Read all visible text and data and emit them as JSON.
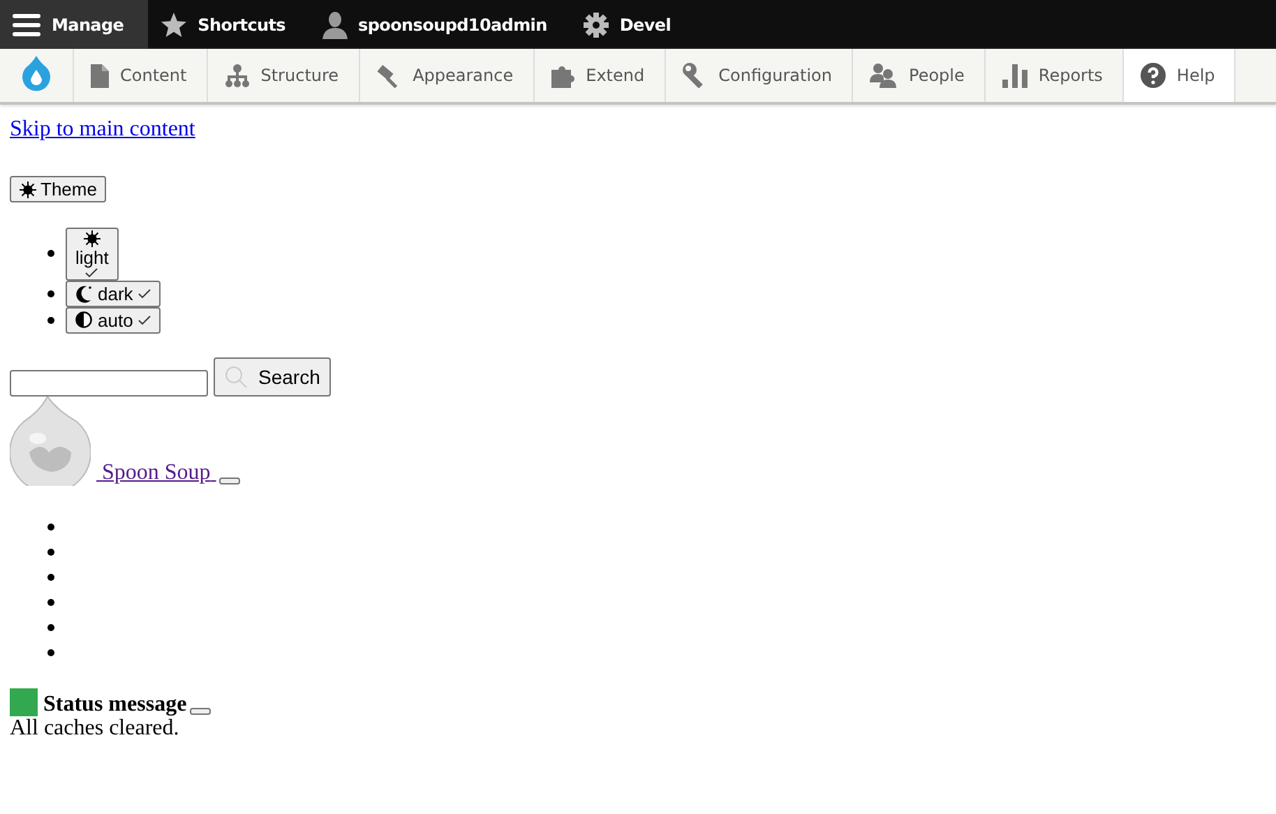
{
  "toolbar": {
    "tabs": [
      {
        "label": "Manage",
        "kind": "menu",
        "selected": true
      },
      {
        "label": "Shortcuts",
        "kind": "star",
        "selected": false
      },
      {
        "label": "spoonsoupd10admin",
        "kind": "user",
        "selected": false
      },
      {
        "label": "Devel",
        "kind": "gear",
        "selected": false
      }
    ],
    "tray": [
      {
        "label": "Content",
        "kind": "content",
        "selected": false
      },
      {
        "label": "Structure",
        "kind": "structure",
        "selected": false
      },
      {
        "label": "Appearance",
        "kind": "appearance",
        "selected": false
      },
      {
        "label": "Extend",
        "kind": "extend",
        "selected": false
      },
      {
        "label": "Configuration",
        "kind": "configuration",
        "selected": false
      },
      {
        "label": "People",
        "kind": "people",
        "selected": false
      },
      {
        "label": "Reports",
        "kind": "reports",
        "selected": false
      },
      {
        "label": "Help",
        "kind": "help",
        "selected": true
      }
    ]
  },
  "skip_link": "Skip to main content",
  "theme_button": "Theme",
  "theme_options": [
    {
      "label": "light",
      "kind": "light",
      "stacked": true
    },
    {
      "label": "dark",
      "kind": "dark",
      "stacked": false
    },
    {
      "label": "auto",
      "kind": "auto",
      "stacked": false
    }
  ],
  "search": {
    "button": "Search"
  },
  "site_name": "Spoon Soup",
  "menu_items": [
    {
      "kind": "empty"
    },
    {
      "kind": "empty"
    },
    {
      "kind": "empty"
    },
    {
      "kind": "empty"
    },
    {
      "kind": "empty"
    },
    {
      "kind": "empty"
    }
  ],
  "status": {
    "title": "Status message",
    "message": "All caches cleared.",
    "color": "#32a94f"
  }
}
